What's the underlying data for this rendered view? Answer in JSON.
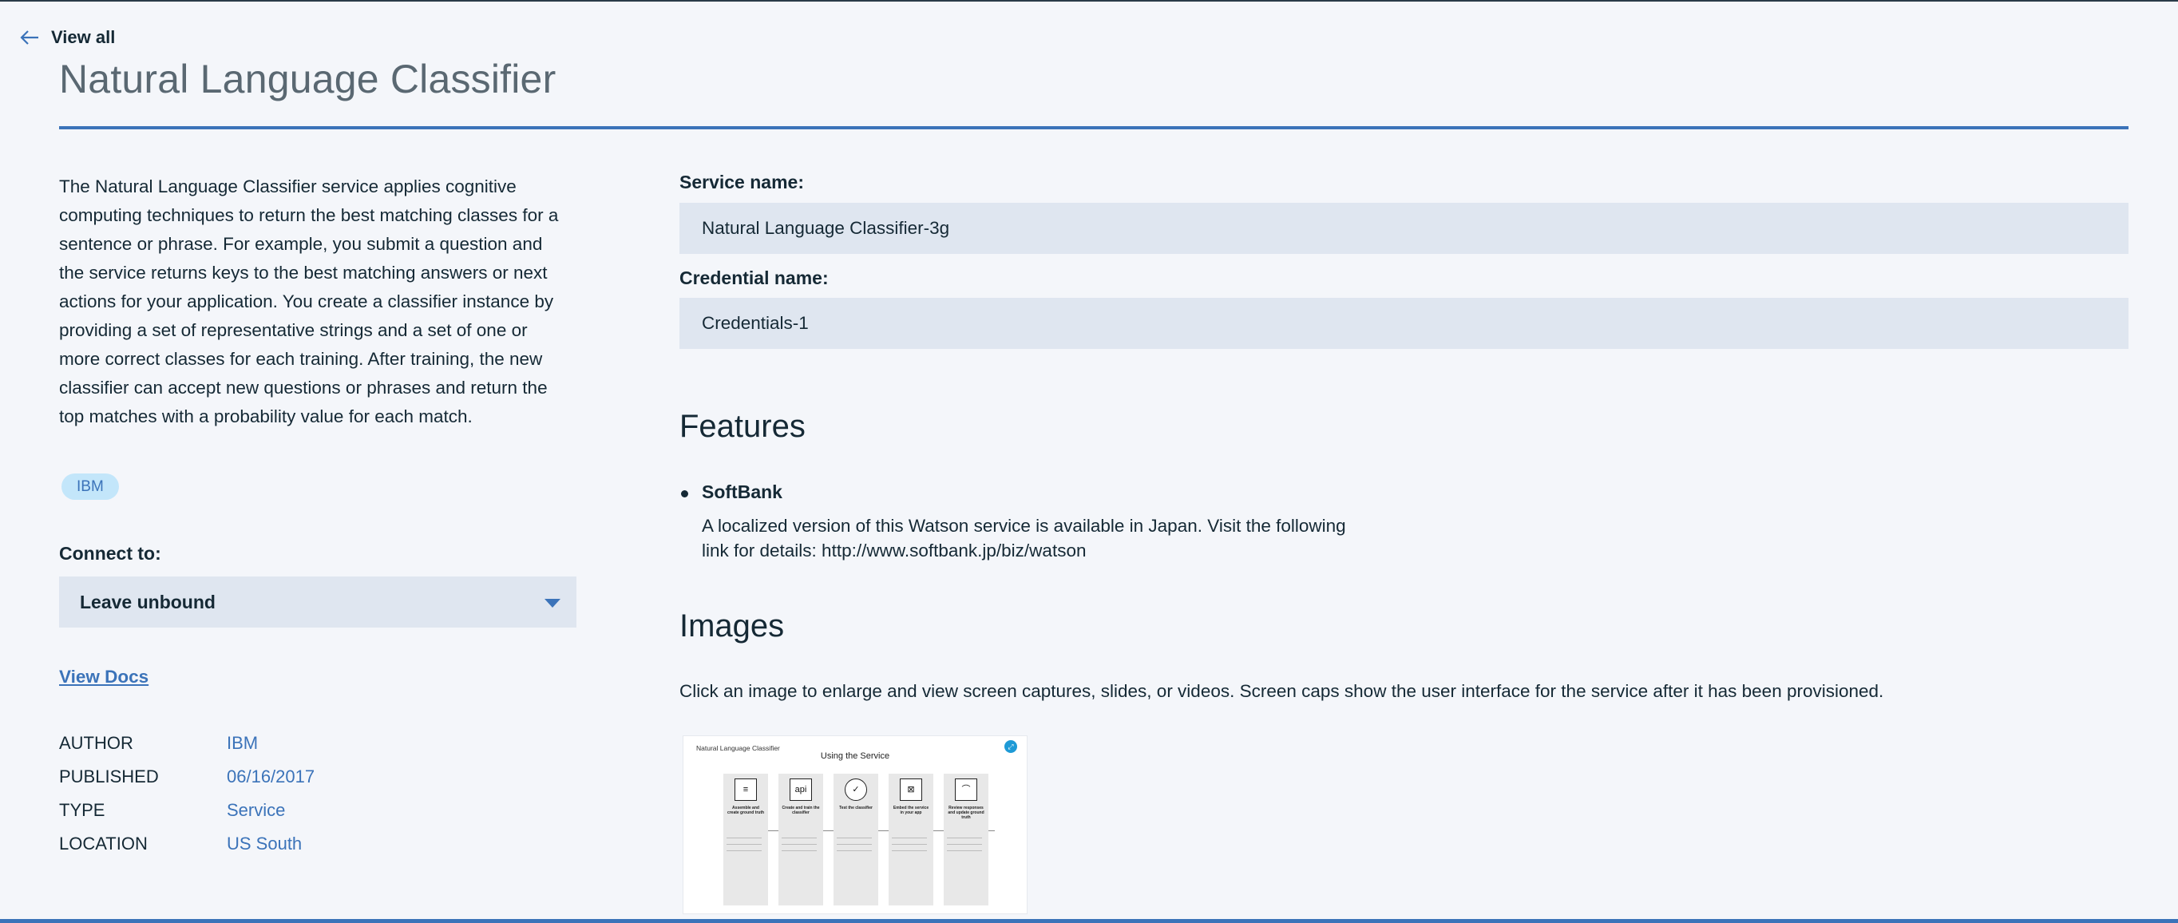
{
  "nav": {
    "back_label": "View all"
  },
  "page": {
    "title": "Natural Language Classifier"
  },
  "description": "The Natural Language Classifier service applies cognitive computing techniques to return the best matching classes for a sentence or phrase. For example, you submit a question and the service returns keys to the best matching answers or next actions for your application. You create a classifier instance by providing a set of representative strings and a set of one or more correct classes for each training. After training, the new classifier can accept new questions or phrases and return the top matches with a probability value for each match.",
  "tag": "IBM",
  "connect": {
    "label": "Connect to:",
    "value": "Leave unbound"
  },
  "docs_link": "View Docs",
  "meta": [
    {
      "key": "AUTHOR",
      "value": "IBM"
    },
    {
      "key": "PUBLISHED",
      "value": "06/16/2017"
    },
    {
      "key": "TYPE",
      "value": "Service"
    },
    {
      "key": "LOCATION",
      "value": "US South"
    }
  ],
  "form": {
    "service_name_label": "Service name:",
    "service_name_value": "Natural Language Classifier-3g",
    "credential_name_label": "Credential name:",
    "credential_name_value": "Credentials-1"
  },
  "features": {
    "heading": "Features",
    "items": [
      {
        "title": "SoftBank",
        "description": "A localized version of this Watson service is available in Japan. Visit the following link for details: http://www.softbank.jp/biz/watson"
      }
    ]
  },
  "images": {
    "heading": "Images",
    "note": "Click an image to enlarge and view screen captures, slides, or videos. Screen caps show the user interface for the service after it has been provisioned.",
    "thumbnail": {
      "header": "Natural Language Classifier",
      "subtitle": "Using the Service",
      "steps": [
        {
          "title": "Assemble and create ground truth",
          "icon": "≡"
        },
        {
          "title": "Create and train the classifier",
          "icon": "api"
        },
        {
          "title": "Test the classifier",
          "icon": "✓"
        },
        {
          "title": "Embed the service in your app",
          "icon": "⊠"
        },
        {
          "title": "Review responses and update ground truth",
          "icon": "⌒"
        }
      ]
    }
  },
  "colors": {
    "accent": "#3b73b9",
    "field_bg": "#dfe6f0",
    "page_bg": "#f4f6fa",
    "tag_bg": "#c3e6fa"
  }
}
